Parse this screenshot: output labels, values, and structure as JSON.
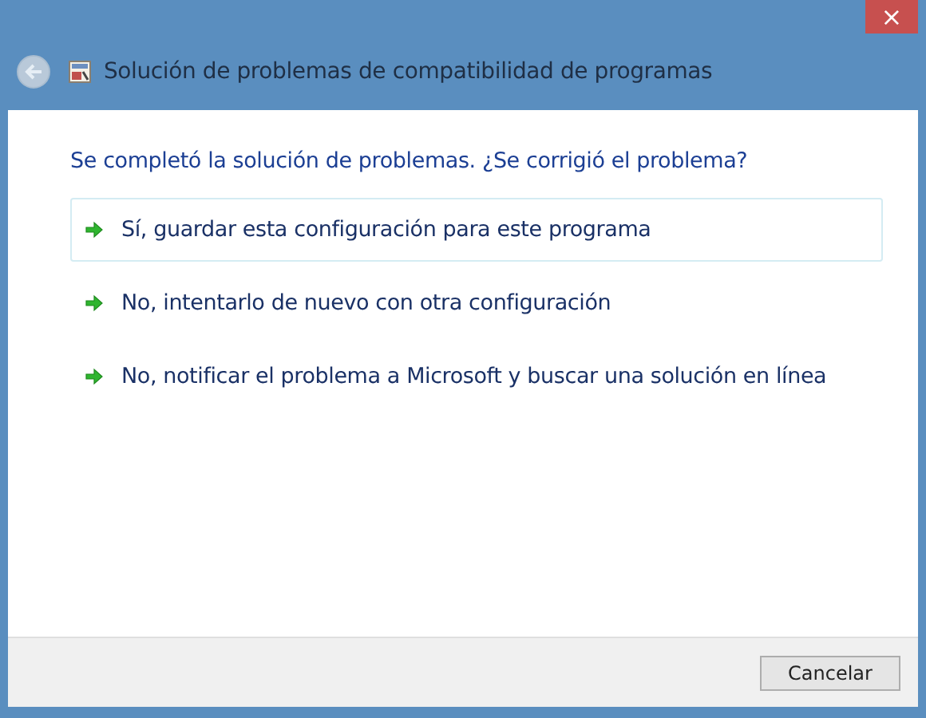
{
  "window": {
    "title": "Solución de problemas de compatibilidad de programas",
    "close": "×"
  },
  "heading": "Se completó la solución de problemas. ¿Se corrigió el problema?",
  "options": [
    {
      "label": "Sí, guardar esta configuración para este programa",
      "selected": true
    },
    {
      "label": "No, intentarlo de nuevo con otra configuración",
      "selected": false
    },
    {
      "label": "No, notificar el problema a Microsoft y buscar una solución en línea",
      "selected": false
    }
  ],
  "buttons": [
    "Cancelar"
  ]
}
